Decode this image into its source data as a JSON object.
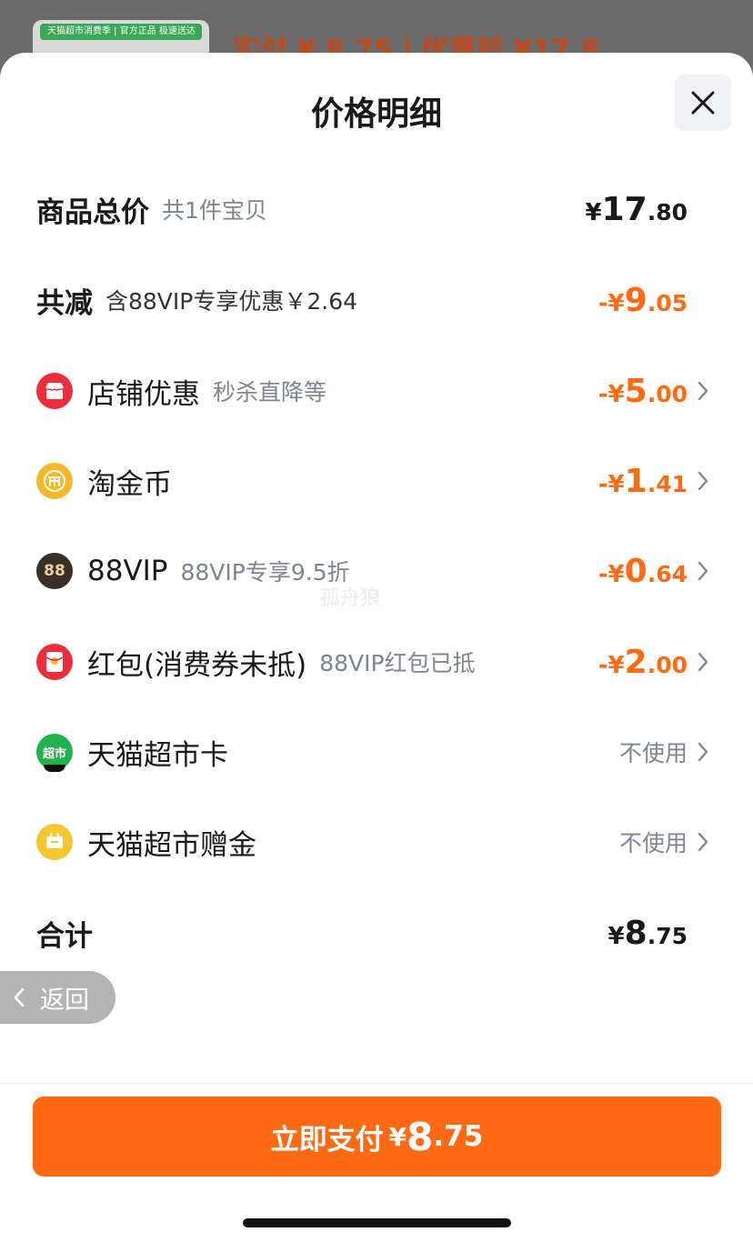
{
  "background": {
    "thumb_strip_text": "天猫超市消费季 | 官方正品 极速送达",
    "price_text": "实付 ¥ 8.75 | 优惠前 ¥17.8"
  },
  "sheet": {
    "title": "价格明细",
    "close_icon": "close-icon"
  },
  "rows": {
    "total": {
      "title": "商品总价",
      "sub": "共1件宝贝",
      "sym": "¥",
      "int": "17",
      "dec": ".80"
    },
    "reduce": {
      "title": "共减",
      "sub": "含88VIP专享优惠￥2.64",
      "sym": "-¥",
      "int": "9",
      "dec": ".05"
    },
    "shop": {
      "title": "店铺优惠",
      "sub": "秒杀直降等",
      "sym": "-¥",
      "int": "5",
      "dec": ".00",
      "icon": "shop-icon"
    },
    "coin": {
      "title": "淘金币",
      "sym": "-¥",
      "int": "1",
      "dec": ".41",
      "icon": "gold-coin-icon"
    },
    "vip": {
      "title": "88VIP",
      "sub": "88VIP专享9.5折",
      "sym": "-¥",
      "int": "0",
      "dec": ".64",
      "icon": "88vip-icon",
      "icon_text": "88"
    },
    "redpack": {
      "title": "红包(消费券未抵)",
      "sub": "88VIP红包已抵",
      "sym": "-¥",
      "int": "2",
      "dec": ".00",
      "icon": "red-packet-icon"
    },
    "card": {
      "title": "天猫超市卡",
      "status": "不使用",
      "icon": "tmall-supermarket-card-icon",
      "icon_text": "超市"
    },
    "bonus": {
      "title": "天猫超市赠金",
      "status": "不使用",
      "icon": "gift-money-icon"
    },
    "sum": {
      "title": "合计",
      "sym": "¥",
      "int": "8",
      "dec": ".75"
    }
  },
  "back_button": {
    "label": "返回"
  },
  "pay_button": {
    "label": "立即支付",
    "sym": "¥",
    "int": "8",
    "dec": ".75"
  },
  "watermark": "孤舟狼",
  "colors": {
    "accent": "#ff6a13",
    "muted": "#7d8592"
  }
}
